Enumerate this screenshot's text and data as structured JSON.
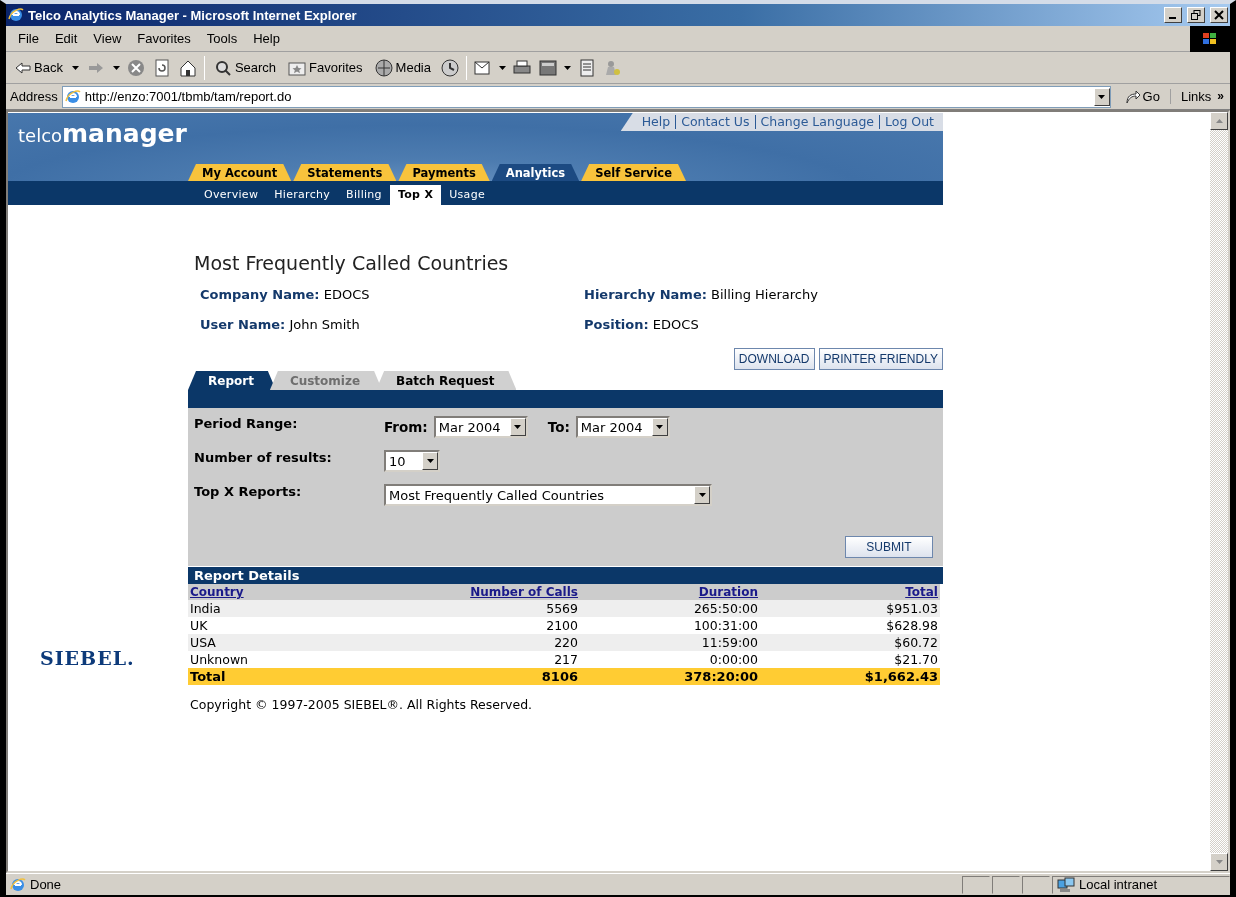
{
  "window": {
    "title": "Telco Analytics Manager - Microsoft Internet Explorer"
  },
  "menu": [
    "File",
    "Edit",
    "View",
    "Favorites",
    "Tools",
    "Help"
  ],
  "toolbar": {
    "back": "Back",
    "search": "Search",
    "favorites": "Favorites",
    "media": "Media"
  },
  "address_bar": {
    "label": "Address",
    "url": "http://enzo:7001/tbmb/tam/report.do",
    "go": "Go",
    "links": "Links",
    "more": "»"
  },
  "page": {
    "logo": {
      "prefix": "telco",
      "name": "manager"
    },
    "top_links": [
      "Help",
      "Contact Us",
      "Change Language",
      "Log Out"
    ],
    "main_tabs": [
      {
        "label": "My Account",
        "selected": false
      },
      {
        "label": "Statements",
        "selected": false
      },
      {
        "label": "Payments",
        "selected": false
      },
      {
        "label": "Analytics",
        "selected": true
      },
      {
        "label": "Self Service",
        "selected": false
      }
    ],
    "sub_tabs": [
      {
        "label": "Overview",
        "selected": false
      },
      {
        "label": "Hierarchy",
        "selected": false
      },
      {
        "label": "Billing",
        "selected": false
      },
      {
        "label": "Top X",
        "selected": true
      },
      {
        "label": "Usage",
        "selected": false
      }
    ],
    "title": "Most Frequently Called Countries",
    "info": [
      {
        "label": "Company Name:",
        "value": "EDOCS"
      },
      {
        "label": "Hierarchy Name:",
        "value": "Billing Hierarchy"
      },
      {
        "label": "User Name:",
        "value": "John Smith"
      },
      {
        "label": "Position:",
        "value": "EDOCS"
      }
    ],
    "actions": [
      "DOWNLOAD",
      "PRINTER FRIENDLY"
    ],
    "form_tabs": [
      {
        "label": "Report",
        "selected": true,
        "disabled": false
      },
      {
        "label": "Customize",
        "selected": false,
        "disabled": true
      },
      {
        "label": "Batch Request",
        "selected": false,
        "disabled": false
      }
    ],
    "form": {
      "period": {
        "label": "Period Range:",
        "from_label": "From:",
        "from": "Mar 2004",
        "to_label": "To:",
        "to": "Mar 2004"
      },
      "results": {
        "label": "Number of results:",
        "value": "10"
      },
      "reports": {
        "label": "Top X Reports:",
        "value": "Most Frequently Called Countries"
      },
      "submit": "SUBMIT"
    },
    "report": {
      "title": "Report Details",
      "columns": [
        "Country",
        "Number of Calls",
        "Duration",
        "Total"
      ],
      "rows": [
        [
          "India",
          "5569",
          "265:50:00",
          "$951.03"
        ],
        [
          "UK",
          "2100",
          "100:31:00",
          "$628.98"
        ],
        [
          "USA",
          "220",
          "11:59:00",
          "$60.72"
        ],
        [
          "Unknown",
          "217",
          "0:00:00",
          "$21.70"
        ]
      ],
      "total": [
        "Total",
        "8106",
        "378:20:00",
        "$1,662.43"
      ]
    },
    "vendor_logo": "SIEBEL.",
    "copyright": "Copyright © 1997-2005 SIEBEL®. All Rights Reserved."
  },
  "status_bar": {
    "text": "Done",
    "zone": "Local intranet"
  }
}
